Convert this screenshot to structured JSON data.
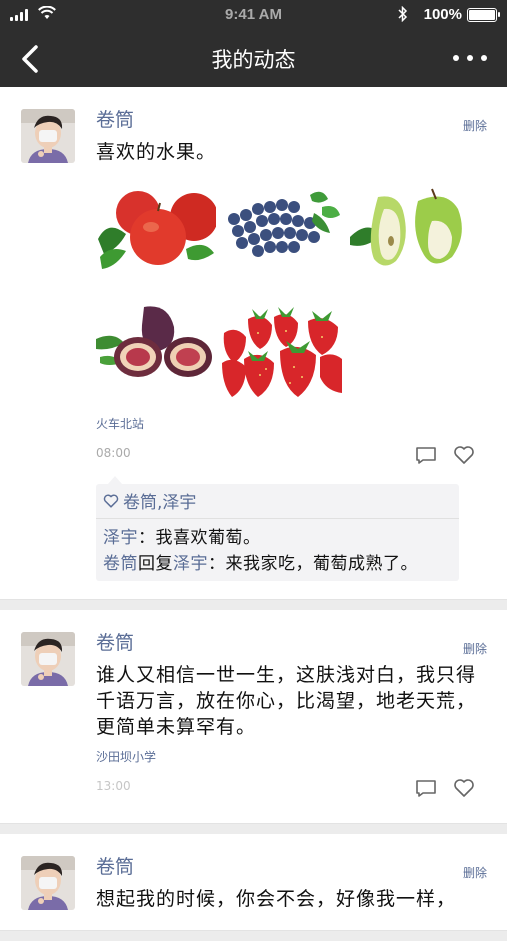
{
  "status": {
    "time": "9:41 AM",
    "battery": "100%",
    "battery_level": 1.0
  },
  "nav": {
    "title": "我的动态"
  },
  "posts": [
    {
      "user": "卷筒",
      "delete_label": "删除",
      "text": "喜欢的水果。",
      "photos": [
        "apples",
        "blueberries",
        "pears",
        "figs",
        "strawberries"
      ],
      "location": "火车北站",
      "time": "08:00",
      "likes": "卷筒,泽宇",
      "comments": [
        {
          "user": "泽宇",
          "text": "：我喜欢葡萄。"
        },
        {
          "user": "卷筒",
          "reply_word": "回复",
          "reply_to": "泽宇",
          "text": "：来我家吃，葡萄成熟了。"
        }
      ]
    },
    {
      "user": "卷筒",
      "delete_label": "删除",
      "text": "谁人又相信一世一生，这肤浅对白，我只得千语万言，放在你心，比渴望，地老天荒，更简单未算罕有。",
      "location": "沙田坝小学",
      "time": "13:00"
    },
    {
      "user": "卷筒",
      "delete_label": "删除",
      "text": "想起我的时候，你会不会，好像我一样，"
    }
  ],
  "icons": {
    "back": "chevron-left-icon",
    "more": "more-icon",
    "comment": "comment-icon",
    "like": "heart-icon"
  },
  "colors": {
    "nav_bg": "#2e2e2e",
    "link": "#5a6d96",
    "muted": "#aaaaaa"
  }
}
